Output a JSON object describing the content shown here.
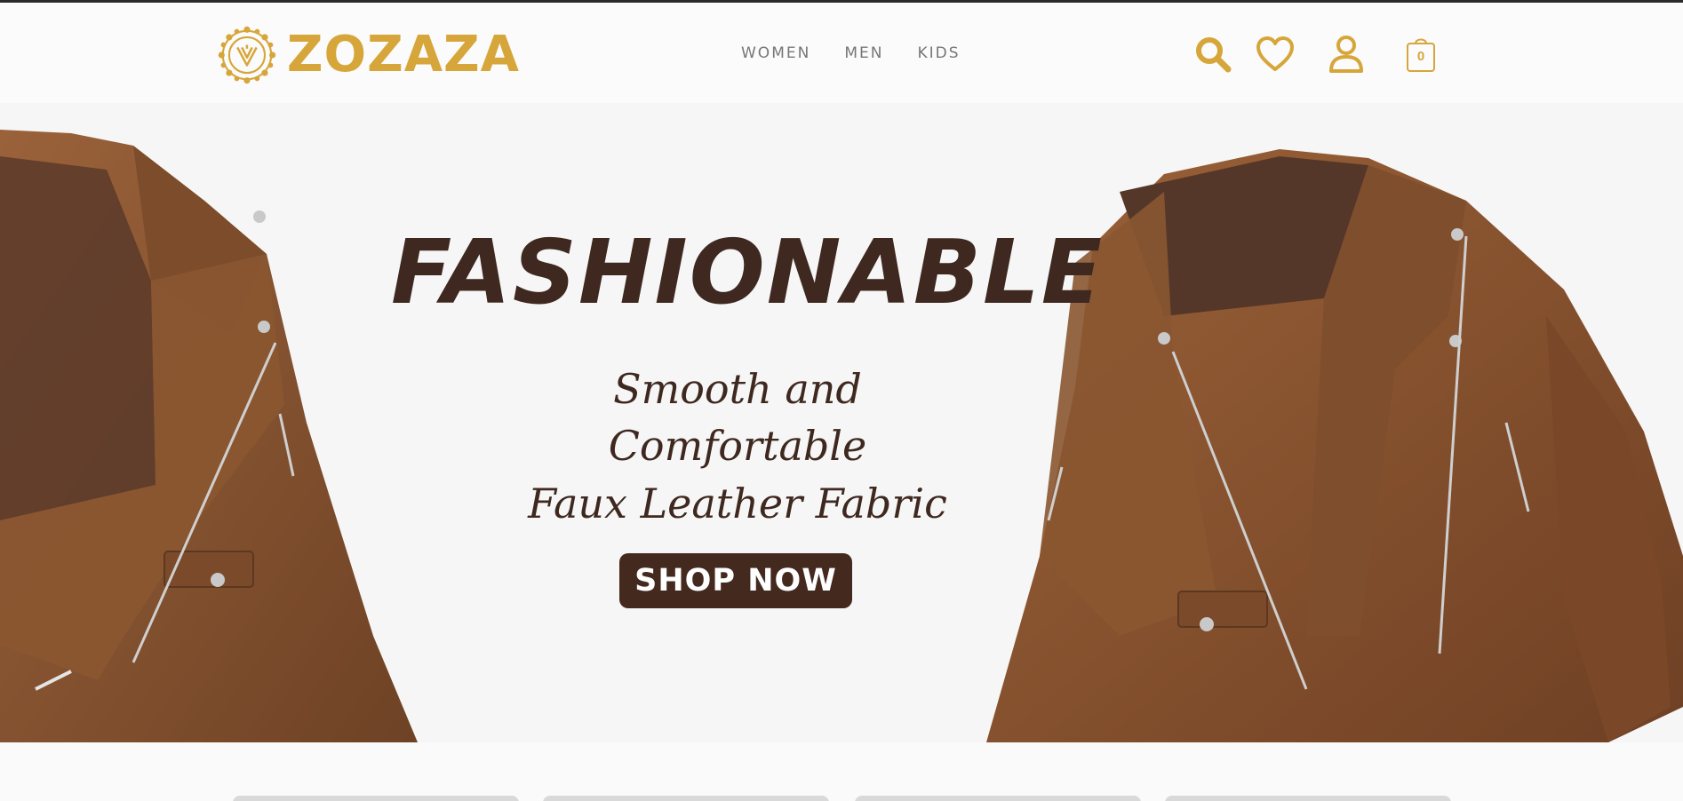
{
  "brand": {
    "name": "ZOZAZA",
    "color": "#d6a63a"
  },
  "nav": {
    "items": [
      "WOMEN",
      "MEN",
      "KIDS"
    ]
  },
  "header_icons": {
    "search": "search-icon",
    "wishlist": "heart-icon",
    "account": "user-icon",
    "cart": "shopping-bag-icon",
    "cart_count": "0"
  },
  "hero": {
    "title": "FASHIONABLE",
    "subtitle_line1": "Smooth and Comfortable",
    "subtitle_line2": "Faux Leather Fabric",
    "cta_label": "SHOP NOW",
    "text_color": "#3e281f",
    "cta_color": "#44291f",
    "jacket_color": "#8a5631"
  }
}
